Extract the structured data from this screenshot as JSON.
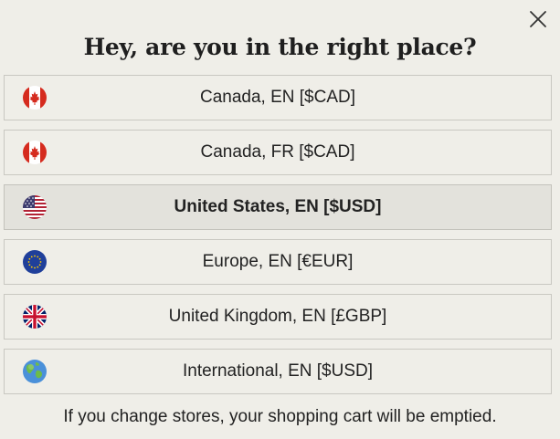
{
  "modal": {
    "close_icon": "close-icon",
    "title": "Hey, are you in the right place?",
    "stores": [
      {
        "label": "Canada, EN [$CAD]",
        "flag": "canada-flag-icon",
        "selected": false
      },
      {
        "label": "Canada, FR [$CAD]",
        "flag": "canada-flag-icon",
        "selected": false
      },
      {
        "label": "United States, EN [$USD]",
        "flag": "usa-flag-icon",
        "selected": true
      },
      {
        "label": "Europe, EN [€EUR]",
        "flag": "eu-flag-icon",
        "selected": false
      },
      {
        "label": "United Kingdom, EN [£GBP]",
        "flag": "uk-flag-icon",
        "selected": false
      },
      {
        "label": "International, EN [$USD]",
        "flag": "globe-icon",
        "selected": false
      }
    ],
    "notice": "If you change stores, your shopping cart will be emptied."
  },
  "colors": {
    "background": "#efeee8",
    "selected_background": "#e3e2dc",
    "border": "#c9c8c1",
    "text": "#1f1f1f"
  }
}
